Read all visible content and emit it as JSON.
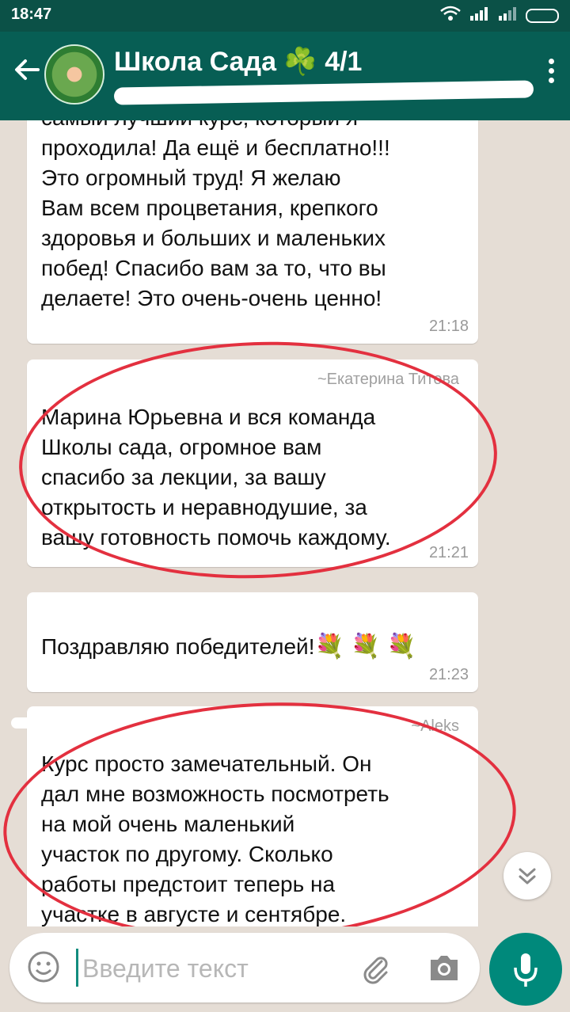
{
  "status_bar": {
    "time": "18:47"
  },
  "header": {
    "title": "Школа Сада ☘️ 4/1"
  },
  "messages": [
    {
      "text": "самый лучший курс, который я\nпроходила! Да ещё и бесплатно!!!\nЭто огромный труд! Я желаю\nВам всем процветания, крепкого\nздоровья и больших и маленьких\nпобед! Спасибо вам за то, что вы\nделаете! Это очень-очень ценно!",
      "time": "21:18"
    },
    {
      "sender": "~Екатерина Титова",
      "text": "Марина Юрьевна и вся команда\nШколы сада, огромное вам\nспасибо за лекции, за вашу\nоткрытость и неравнодушие, за\nвашу готовность помочь каждому.",
      "time": "21:21"
    },
    {
      "text": "Поздравляю победителей!",
      "emoji": "💐 💐 💐",
      "time": "21:23"
    },
    {
      "sender": "~Aleks",
      "text": "Курс просто замечательный. Он\nдал мне возможность посмотреть\nна мой очень маленький\nучасток по другому. Сколько\nработы предстоит теперь на\nучастке в августе и сентябре."
    }
  ],
  "composer": {
    "placeholder": "Введите текст"
  },
  "colors": {
    "header": "#075e54",
    "status_bar": "#0b5147",
    "accent": "#00897b",
    "chat_bg": "#e5ddd5",
    "annotation": "#e3303f"
  }
}
